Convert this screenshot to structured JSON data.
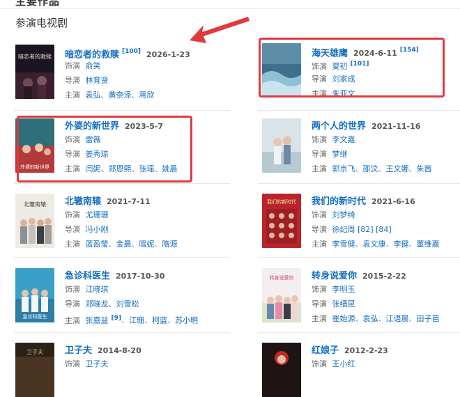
{
  "header": {
    "cut_title": "主要作品"
  },
  "section": {
    "title": "参演电视剧"
  },
  "dramas": [
    {
      "title": "暗恋者的救赎",
      "date": "2026-1-23",
      "ref": "[100]",
      "role_label": "饰演",
      "role": "俞笑",
      "director_label": "导演",
      "directors": [
        "林育贤"
      ],
      "cast_label": "主演",
      "cast": [
        "袁弘",
        "黄奈泽",
        "蒋欣"
      ]
    },
    {
      "title": "海天雄鹰",
      "date": "2024-6-11",
      "ref": "[154]",
      "role_label": "饰演",
      "role": "夏初",
      "role_ref": "[101]",
      "director_label": "导演",
      "directors": [
        "刘家成"
      ],
      "cast_label": "主演",
      "cast": [
        "朱亚文"
      ]
    },
    {
      "title": "外婆的新世界",
      "date": "2023-5-7",
      "ref": "",
      "role_label": "饰演",
      "role": "雷薇",
      "director_label": "导演",
      "directors": [
        "姜秀琼"
      ],
      "cast_label": "主演",
      "cast": [
        "闫妮",
        "郑恩熙",
        "张瑶",
        "姚晨"
      ]
    },
    {
      "title": "两个人的世界",
      "date": "2021-11-16",
      "ref": "",
      "role_label": "饰演",
      "role": "李文嘉",
      "director_label": "导演",
      "directors": [
        "梦继"
      ],
      "cast_label": "主演",
      "cast": [
        "郭京飞",
        "邵汶",
        "王文娜",
        "朱茜"
      ]
    },
    {
      "title": "北辙南辕",
      "date": "2021-7-11",
      "ref": "",
      "role_label": "饰演",
      "role": "尤珊珊",
      "director_label": "导演",
      "directors": [
        "冯小刚"
      ],
      "cast_label": "主演",
      "cast": [
        "蓝盈莹",
        "金晨",
        "啜妮",
        "隋源"
      ]
    },
    {
      "title": "我们的新时代",
      "date": "2021-6-16",
      "ref": "",
      "role_label": "饰演",
      "role": "刘梦绮",
      "director_label": "导演",
      "directors": [
        "徐纪周"
      ],
      "director_refs": [
        "[82]",
        "[84]"
      ],
      "cast_label": "主演",
      "cast": [
        "李雪健",
        "袁文康",
        "李健",
        "董维嘉"
      ]
    },
    {
      "title": "急诊科医生",
      "date": "2017-10-30",
      "ref": "",
      "role_label": "饰演",
      "role": "江晓琪",
      "director_label": "导演",
      "directors": [
        "郑晓龙",
        "刘雪松"
      ],
      "cast_label": "主演",
      "cast": [
        "张嘉益",
        "江珊",
        "柯蓝",
        "苏小明"
      ],
      "cast_ref": "[9]"
    },
    {
      "title": "转身说爱你",
      "date": "2015-2-22",
      "ref": "",
      "role_label": "饰演",
      "role": "李明玉",
      "director_label": "导演",
      "directors": [
        "张缙昆"
      ],
      "cast_label": "主演",
      "cast": [
        "崔始源",
        "袁弘",
        "江语晨",
        "田子芭"
      ]
    },
    {
      "title": "卫子夫",
      "date": "2014-8-20",
      "ref": "",
      "role_label": "饰演",
      "role": "卫子夫",
      "director_label": "",
      "directors": [],
      "cast_label": "",
      "cast": []
    },
    {
      "title": "红娘子",
      "date": "2012-2-23",
      "ref": "",
      "role_label": "饰演",
      "role": "王小红",
      "director_label": "",
      "directors": [],
      "cast_label": "",
      "cast": []
    }
  ],
  "poster_texts": {
    "p0": "暗恋者的救赎",
    "p2": "外婆的新世界",
    "p4": "北辙南辕",
    "p5": "我们的新时代",
    "p6": "急诊科医生",
    "p7": "转身说爱你",
    "p8": "卫子夫"
  },
  "colors": {
    "link": "#136ec2",
    "highlight_box": "#e0393e",
    "arrow": "#e0393e"
  },
  "icons": {
    "annotation_arrow": "red-arrow-icon"
  }
}
